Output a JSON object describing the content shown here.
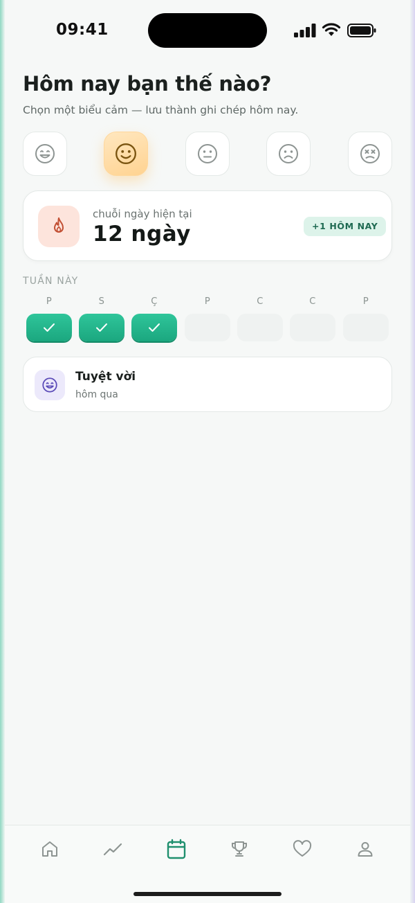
{
  "status_bar": {
    "time": "09:41"
  },
  "header": {
    "title": "Hôm nay bạn thế nào?",
    "subtitle": "Chọn một biểu cảm — lưu thành ghi chép hôm nay."
  },
  "moods": [
    {
      "icon": "laughing-face-icon",
      "selected": false
    },
    {
      "icon": "smiling-face-icon",
      "selected": true
    },
    {
      "icon": "neutral-face-icon",
      "selected": false
    },
    {
      "icon": "sad-face-icon",
      "selected": false
    },
    {
      "icon": "dizzy-face-icon",
      "selected": false
    }
  ],
  "streak": {
    "icon": "flame-icon",
    "label": "chuỗi ngày hiện tại",
    "value": "12 ngày",
    "badge": "+1 HÔM NAY"
  },
  "week": {
    "label": "TUẦN NÀY",
    "days": [
      {
        "letter": "P",
        "done": true
      },
      {
        "letter": "S",
        "done": true
      },
      {
        "letter": "Ç",
        "done": true
      },
      {
        "letter": "P",
        "done": false
      },
      {
        "letter": "C",
        "done": false
      },
      {
        "letter": "C",
        "done": false
      },
      {
        "letter": "P",
        "done": false
      }
    ]
  },
  "history": {
    "icon": "laughing-face-icon",
    "title": "Tuyệt vời",
    "subtitle": "hôm qua"
  },
  "tab_bar": {
    "tabs": [
      {
        "icon": "home-icon",
        "active": false
      },
      {
        "icon": "trend-icon",
        "active": false
      },
      {
        "icon": "calendar-icon",
        "active": true
      },
      {
        "icon": "trophy-icon",
        "active": false
      },
      {
        "icon": "heart-icon",
        "active": false
      },
      {
        "icon": "profile-icon",
        "active": false
      }
    ]
  },
  "colors": {
    "accent": "#1f8f6e",
    "check_green": "#23b58b",
    "mood_selected": "#ffd79c",
    "flame_bg": "#fde4dc",
    "flame": "#c24f33"
  }
}
